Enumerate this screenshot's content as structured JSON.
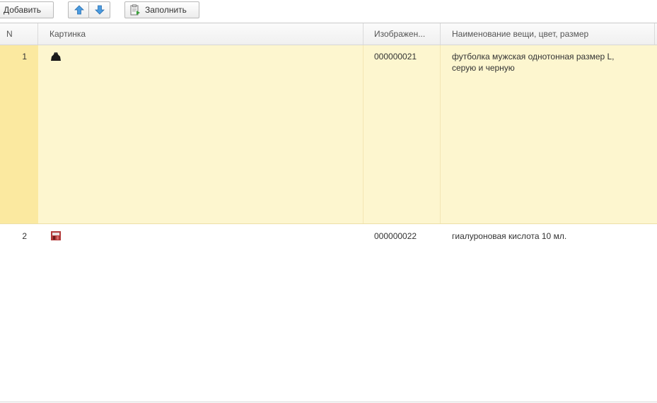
{
  "toolbar": {
    "add_label": "Добавить",
    "fill_label": "Заполнить",
    "up_icon": "arrow-up-icon",
    "down_icon": "arrow-down-icon",
    "fill_icon": "fill-clipboard-icon"
  },
  "table": {
    "columns": [
      "N",
      "Картинка",
      "Изображен...",
      "Наименование вещи, цвет, размер"
    ],
    "rows": [
      {
        "n": "1",
        "picture": "thumbnail-black-tshirt",
        "image_code": "000000021",
        "name": "футболка мужская однотонная размер L, серую и черную",
        "selected": true
      },
      {
        "n": "2",
        "picture": "thumbnail-red-box",
        "image_code": "000000022",
        "name": "гиалуроновая кислота 10 мл.",
        "selected": false
      }
    ]
  },
  "colors": {
    "selected_row": "#fdf6cf",
    "selected_number_cell": "#fbe9a0",
    "header_background": "#f3f3f3",
    "arrow_blue": "#3f8fd8"
  }
}
